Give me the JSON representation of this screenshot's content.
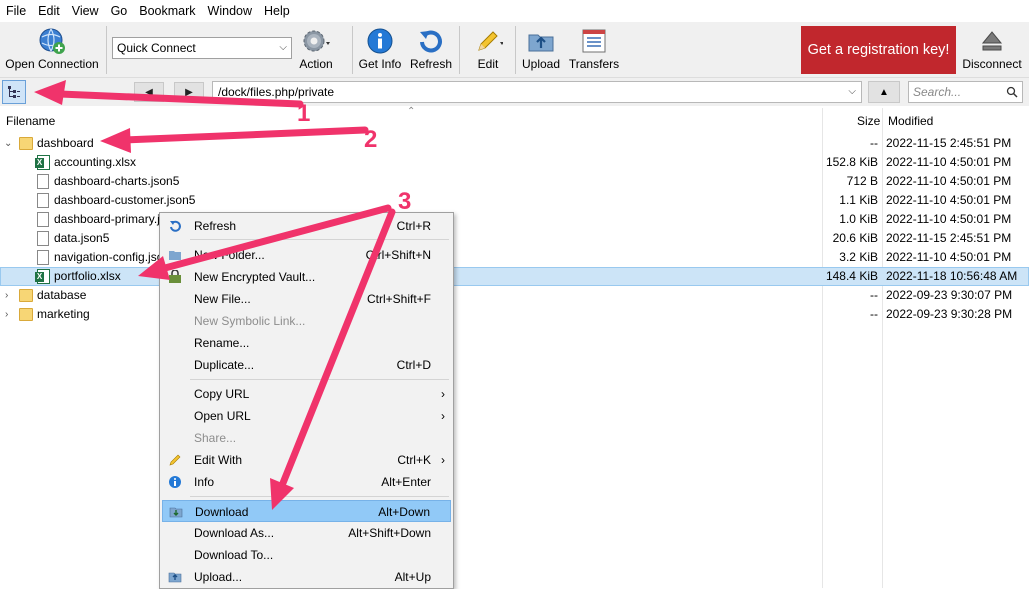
{
  "menu": [
    "File",
    "Edit",
    "View",
    "Go",
    "Bookmark",
    "Window",
    "Help"
  ],
  "toolbar": {
    "open_connection": "Open Connection",
    "quick_connect": "Quick Connect",
    "action": "Action",
    "get_info": "Get Info",
    "refresh": "Refresh",
    "edit": "Edit",
    "upload": "Upload",
    "transfers": "Transfers",
    "registration": "Get a registration key!",
    "disconnect": "Disconnect"
  },
  "nav": {
    "path": "/dock/files.php/private",
    "search_placeholder": "Search..."
  },
  "columns": {
    "filename": "Filename",
    "size": "Size",
    "modified": "Modified"
  },
  "files": [
    {
      "name": "dashboard",
      "size": "--",
      "modified": "2022-11-15 2:45:51 PM"
    },
    {
      "name": "accounting.xlsx",
      "size": "152.8 KiB",
      "modified": "2022-11-10 4:50:01 PM"
    },
    {
      "name": "dashboard-charts.json5",
      "size": "712 B",
      "modified": "2022-11-10 4:50:01 PM"
    },
    {
      "name": "dashboard-customer.json5",
      "size": "1.1 KiB",
      "modified": "2022-11-10 4:50:01 PM"
    },
    {
      "name": "dashboard-primary.json5",
      "size": "1.0 KiB",
      "modified": "2022-11-10 4:50:01 PM"
    },
    {
      "name": "data.json5",
      "size": "20.6 KiB",
      "modified": "2022-11-15 2:45:51 PM"
    },
    {
      "name": "navigation-config.json5",
      "size": "3.2 KiB",
      "modified": "2022-11-10 4:50:01 PM"
    },
    {
      "name": "portfolio.xlsx",
      "size": "148.4 KiB",
      "modified": "2022-11-18 10:56:48 AM"
    },
    {
      "name": "database",
      "size": "--",
      "modified": "2022-09-23 9:30:07 PM"
    },
    {
      "name": "marketing",
      "size": "--",
      "modified": "2022-09-23 9:30:28 PM"
    }
  ],
  "context_menu": [
    {
      "label": "Refresh",
      "shortcut": "Ctrl+R"
    },
    {
      "label": "New Folder...",
      "shortcut": "Ctrl+Shift+N"
    },
    {
      "label": "New Encrypted Vault...",
      "shortcut": ""
    },
    {
      "label": "New File...",
      "shortcut": "Ctrl+Shift+F"
    },
    {
      "label": "New Symbolic Link...",
      "shortcut": ""
    },
    {
      "label": "Rename...",
      "shortcut": ""
    },
    {
      "label": "Duplicate...",
      "shortcut": "Ctrl+D"
    },
    {
      "label": "Copy URL",
      "shortcut": ""
    },
    {
      "label": "Open URL",
      "shortcut": ""
    },
    {
      "label": "Share...",
      "shortcut": ""
    },
    {
      "label": "Edit With",
      "shortcut": "Ctrl+K"
    },
    {
      "label": "Info",
      "shortcut": "Alt+Enter"
    },
    {
      "label": "Download",
      "shortcut": "Alt+Down"
    },
    {
      "label": "Download As...",
      "shortcut": "Alt+Shift+Down"
    },
    {
      "label": "Download To...",
      "shortcut": ""
    },
    {
      "label": "Upload...",
      "shortcut": "Alt+Up"
    }
  ],
  "annotations": [
    "1",
    "2",
    "3"
  ],
  "colors": {
    "accent_red": "#c1272d",
    "arrow_pink": "#f0336b",
    "selection": "#cce4f7",
    "menu_highlight": "#91c9f7"
  }
}
